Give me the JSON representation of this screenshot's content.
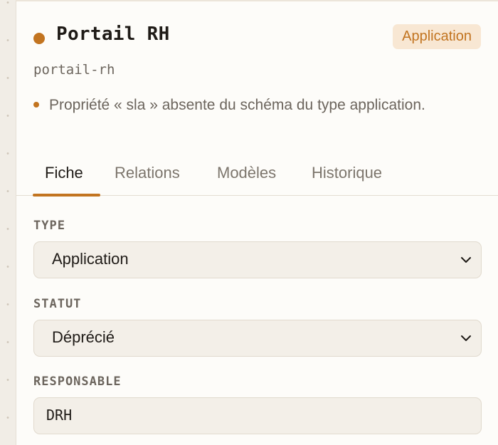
{
  "entity": {
    "title": "Portail RH",
    "type_badge": "Application",
    "slug": "portail-rh",
    "warning": "Propriété « sla » absente du schéma du type application."
  },
  "tabs": [
    {
      "label": "Fiche",
      "active": true
    },
    {
      "label": "Relations",
      "active": false
    },
    {
      "label": "Modèles",
      "active": false
    },
    {
      "label": "Historique",
      "active": false
    }
  ],
  "fields": {
    "type": {
      "label": "TYPE",
      "value": "Application"
    },
    "status": {
      "label": "STATUT",
      "value": "Déprécié"
    },
    "owner": {
      "label": "RESPONSABLE",
      "value": "DRH"
    }
  },
  "icons": {
    "chevron": "chevron-down-icon",
    "status_dot": "status-dot-icon",
    "warning_dot": "warning-dot-icon"
  },
  "colors": {
    "accent": "#c27420",
    "badge_bg": "#f8e7d3",
    "text": "#1f1b17",
    "muted": "#6c655d"
  }
}
